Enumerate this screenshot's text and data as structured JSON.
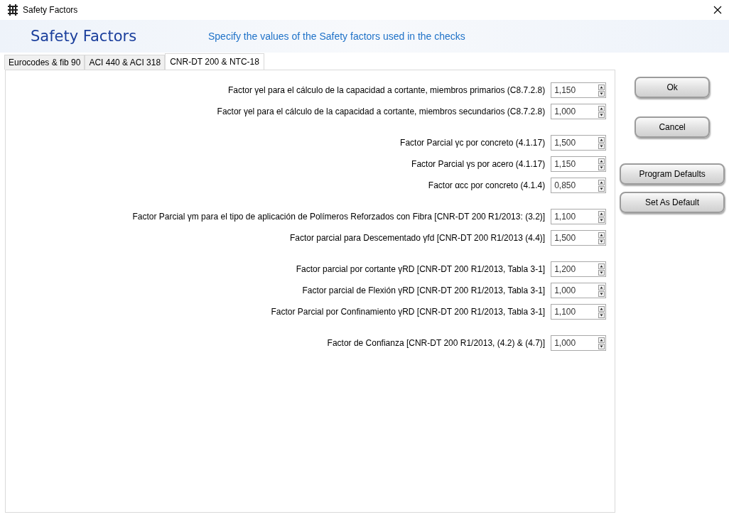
{
  "window": {
    "title": "Safety Factors"
  },
  "header": {
    "title": "Safety Factors",
    "subtitle": "Specify the values of the Safety factors used in the checks"
  },
  "tabs": [
    {
      "label": "Eurocodes & fib 90",
      "selected": false
    },
    {
      "label": "ACI 440 & ACI 318",
      "selected": false
    },
    {
      "label": "CNR-DT 200 & NTC-18",
      "selected": true
    }
  ],
  "groups": [
    {
      "rows": [
        {
          "label": "Factor γel para el cálculo de la capacidad a cortante, miembros primarios (C8.7.2.8)",
          "value": "1,150"
        },
        {
          "label": "Factor γel para el cálculo de la capacidad a cortante, miembros secundarios (C8.7.2.8)",
          "value": "1,000"
        }
      ]
    },
    {
      "rows": [
        {
          "label": "Factor Parcial γc por concreto (4.1.17)",
          "value": "1,500"
        },
        {
          "label": "Factor Parcial γs por acero (4.1.17)",
          "value": "1,150"
        },
        {
          "label": "Factor αcc por concreto (4.1.4)",
          "value": "0,850"
        }
      ]
    },
    {
      "rows": [
        {
          "label": "Factor Parcial γm para el tipo de aplicación de Polímeros Reforzados con Fibra [CNR-DT 200 R1/2013: (3.2)]",
          "value": "1,100"
        },
        {
          "label": "Factor parcial para Descementado γfd [CNR-DT 200 R1/2013 (4.4)]",
          "value": "1,500"
        }
      ]
    },
    {
      "rows": [
        {
          "label": "Factor parcial por cortante γRD [CNR-DT 200 R1/2013, Tabla 3-1]",
          "value": "1,200"
        },
        {
          "label": "Factor parcial de Flexión γRD [CNR-DT 200 R1/2013, Tabla 3-1]",
          "value": "1,000"
        },
        {
          "label": "Factor Parcial por Confinamiento γRD [CNR-DT 200 R1/2013, Tabla 3-1]",
          "value": "1,100"
        }
      ]
    },
    {
      "rows": [
        {
          "label": "Factor de Confianza [CNR-DT 200 R1/2013, (4.2) & (4.7)]",
          "value": "1,000"
        }
      ]
    }
  ],
  "buttons": [
    {
      "label": "Ok",
      "kind": "narrow"
    },
    {
      "label": "Cancel",
      "kind": "narrow"
    },
    {
      "label": "Program Defaults",
      "kind": "wide"
    },
    {
      "label": "Set As Default",
      "kind": "wide"
    }
  ]
}
